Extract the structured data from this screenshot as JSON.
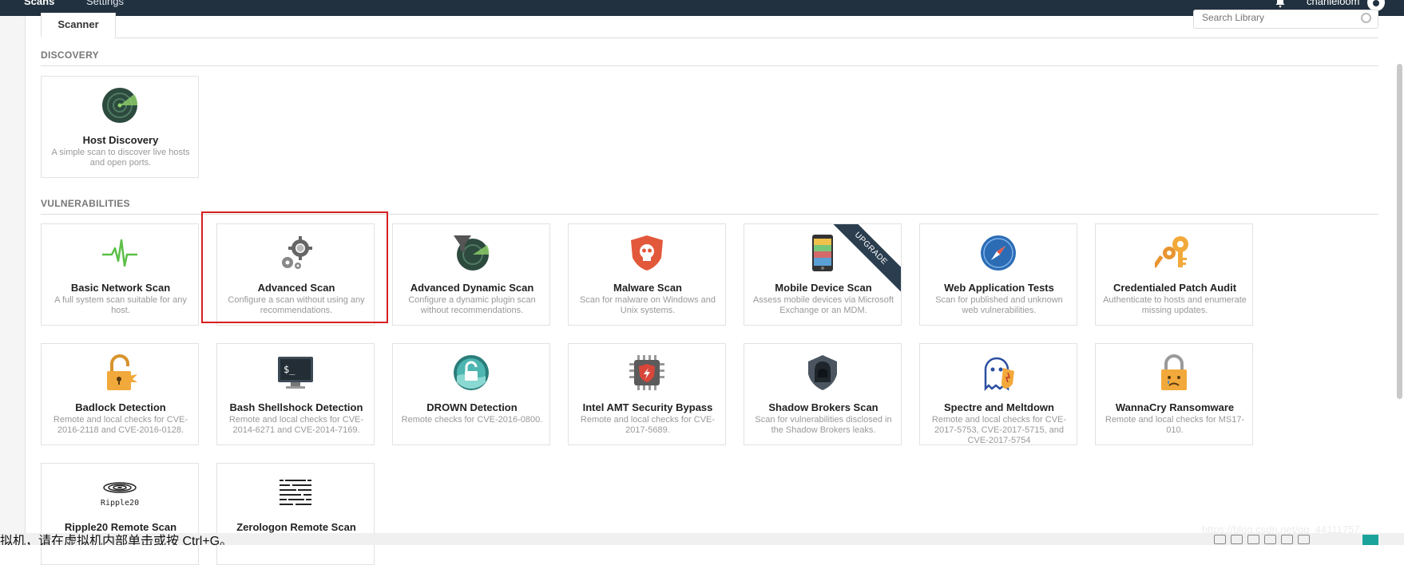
{
  "topnav": {
    "scans": "Scans",
    "settings": "Settings",
    "user": "chanieloom"
  },
  "tab": "Scanner",
  "search": {
    "placeholder": "Search Library"
  },
  "sections": {
    "discovery": "DISCOVERY",
    "vulnerabilities": "VULNERABILITIES"
  },
  "cards": [
    {
      "title": "Host Discovery",
      "desc": "A simple scan to discover live hosts and open ports.",
      "icon": "radar-icon"
    },
    {
      "title": "Basic Network Scan",
      "desc": "A full system scan suitable for any host.",
      "icon": "pulse-icon"
    },
    {
      "title": "Advanced Scan",
      "desc": "Configure a scan without using any recommendations.",
      "icon": "gears-icon"
    },
    {
      "title": "Advanced Dynamic Scan",
      "desc": "Configure a dynamic plugin scan without recommendations.",
      "icon": "radar-filter-icon"
    },
    {
      "title": "Malware Scan",
      "desc": "Scan for malware on Windows and Unix systems.",
      "icon": "skull-shield-icon"
    },
    {
      "title": "Mobile Device Scan",
      "desc": "Assess mobile devices via Microsoft Exchange or an MDM.",
      "icon": "phone-icon",
      "badge": "UPGRADE"
    },
    {
      "title": "Web Application Tests",
      "desc": "Scan for published and unknown web vulnerabilities.",
      "icon": "compass-icon"
    },
    {
      "title": "Credentialed Patch Audit",
      "desc": "Authenticate to hosts and enumerate missing updates.",
      "icon": "keys-icon"
    },
    {
      "title": "Badlock Detection",
      "desc": "Remote and local checks for CVE-2016-2118 and CVE-2016-0128.",
      "icon": "broken-lock-icon"
    },
    {
      "title": "Bash Shellshock Detection",
      "desc": "Remote and local checks for CVE-2014-6271 and CVE-2014-7169.",
      "icon": "terminal-icon"
    },
    {
      "title": "DROWN Detection",
      "desc": "Remote checks for CVE-2016-0800.",
      "icon": "drown-lock-icon"
    },
    {
      "title": "Intel AMT Security Bypass",
      "desc": "Remote and local checks for CVE-2017-5689.",
      "icon": "chip-icon"
    },
    {
      "title": "Shadow Brokers Scan",
      "desc": "Scan for vulnerabilities disclosed in the Shadow Brokers leaks.",
      "icon": "hooded-figure-icon"
    },
    {
      "title": "Spectre and Meltdown",
      "desc": "Remote and local checks for CVE-2017-5753, CVE-2017-5715, and CVE-2017-5754",
      "icon": "ghost-icon"
    },
    {
      "title": "WannaCry Ransomware",
      "desc": "Remote and local checks for MS17-010.",
      "icon": "crying-lock-icon"
    },
    {
      "title": "Ripple20 Remote Scan",
      "desc": "",
      "icon": "ripple20-logo-icon",
      "logo_text": "Ripple20"
    },
    {
      "title": "Zerologon Remote Scan",
      "desc": "",
      "icon": "zerologon-logo-icon"
    }
  ],
  "taskbar": {
    "message": "拟机，请在虚拟机内部单击或按 Ctrl+G。"
  },
  "watermark": "https://blog.csdn.net/qq_44111757",
  "colors": {
    "topbar": "#22313f",
    "highlight": "#d62020",
    "ribbon": "#2b3e50",
    "teal": "#1aa39a"
  }
}
